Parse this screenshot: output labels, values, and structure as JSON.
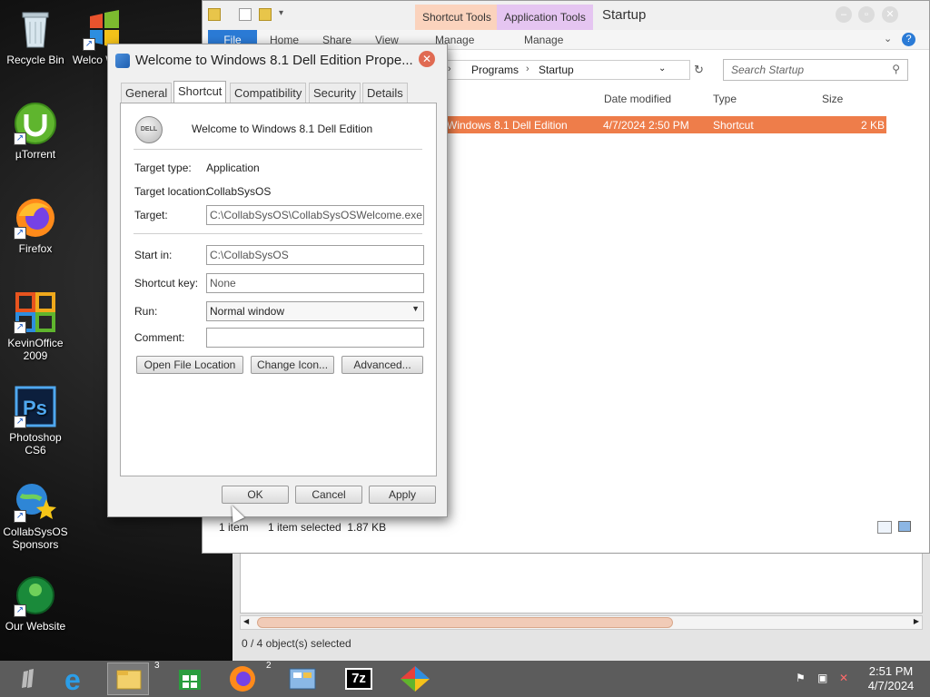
{
  "desktop": {
    "icons": [
      {
        "label": "Recycle Bin"
      },
      {
        "label": "Welcome to Windows 8.1 Dell Edition",
        "short_label": "Welco Windo"
      },
      {
        "label": "µTorrent"
      },
      {
        "label": "Firefox"
      },
      {
        "label": "KevinOffice 2009"
      },
      {
        "label": "Photoshop CS6"
      },
      {
        "label": "CollabSysOS Sponsors"
      },
      {
        "label": "Our Website"
      }
    ]
  },
  "explorer": {
    "title": "Startup",
    "context_tabs": [
      "Shortcut Tools",
      "Application Tools"
    ],
    "context_groups": [
      "Manage",
      "Manage"
    ],
    "ribbon_tabs": [
      "File",
      "Home",
      "Share",
      "View"
    ],
    "breadcrumb": [
      "Programs",
      "Startup"
    ],
    "search_placeholder": "Search Startup",
    "columns": [
      "Date modified",
      "Type",
      "Size"
    ],
    "file": {
      "name": "Windows 8.1 Dell Edition",
      "date": "4/7/2024 2:50 PM",
      "type": "Shortcut",
      "size": "2 KB"
    },
    "status": {
      "count": "1 item",
      "selected": "1 item selected  1.87 KB"
    },
    "colors": {
      "selection": "#ee7d4a",
      "file_tab": "#2b7bd6",
      "shortcut_tools": "#fbd3bd",
      "application_tools": "#e5c5f1"
    }
  },
  "lower_panel": {
    "status": "0 / 4 object(s) selected"
  },
  "dialog": {
    "title": "Welcome to Windows 8.1 Dell Edition Prope...",
    "tabs": [
      "General",
      "Shortcut",
      "Compatibility",
      "Security",
      "Details"
    ],
    "active_tab": "Shortcut",
    "shortcut_name": "Welcome to Windows 8.1 Dell Edition",
    "labels": {
      "target_type": "Target type:",
      "target_location": "Target location:",
      "target": "Target:",
      "start_in": "Start in:",
      "shortcut_key": "Shortcut key:",
      "run": "Run:",
      "comment": "Comment:"
    },
    "values": {
      "target_type": "Application",
      "target_location": "CollabSysOS",
      "target": "C:\\CollabSysOS\\CollabSysOSWelcome.exe",
      "start_in": "C:\\CollabSysOS",
      "shortcut_key": "None",
      "run": "Normal window",
      "comment": ""
    },
    "buttons": {
      "open_file_location": "Open File Location",
      "change_icon": "Change Icon...",
      "advanced": "Advanced...",
      "ok": "OK",
      "cancel": "Cancel",
      "apply": "Apply"
    },
    "logo_text": "DELL"
  },
  "taskbar": {
    "explorer_badge": "3",
    "firefox_badge": "2",
    "sevenzip_label": "7z",
    "clock_time": "2:51 PM",
    "clock_date": "4/7/2024"
  }
}
